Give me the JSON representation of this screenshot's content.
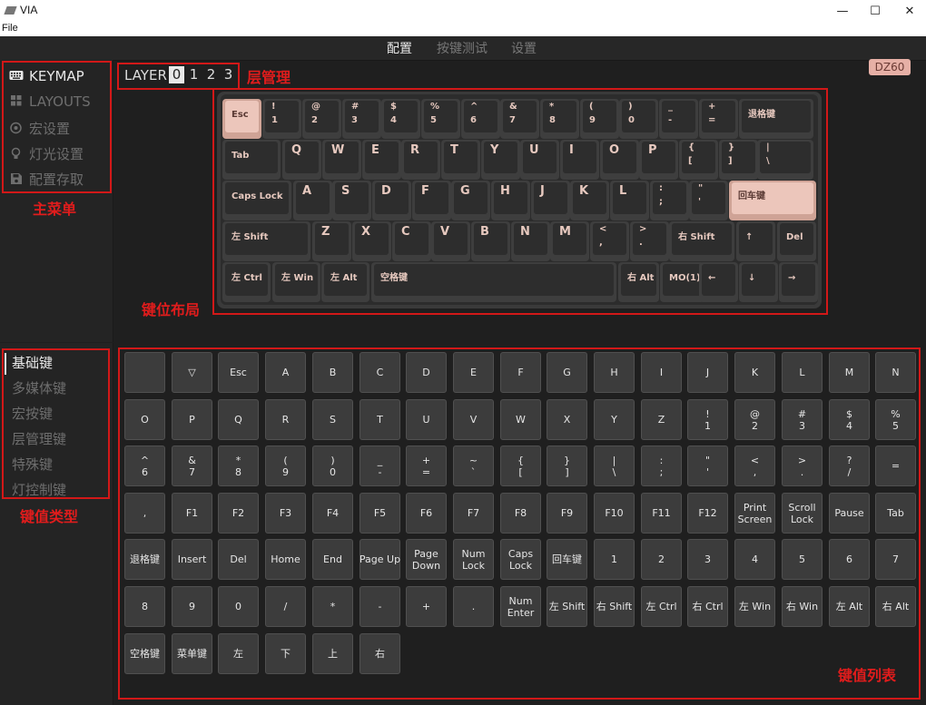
{
  "window": {
    "title": "VIA",
    "menu_file": "File",
    "minimize": "—",
    "maximize": "☐",
    "close": "✕"
  },
  "tabs": [
    "配置",
    "按键测试",
    "设置"
  ],
  "sidebar": {
    "items": [
      {
        "label": "KEYMAP",
        "icon": "keyboard-icon",
        "active": true
      },
      {
        "label": "LAYOUTS",
        "icon": "layouts-icon",
        "active": false
      },
      {
        "label": "宏设置",
        "icon": "macro-icon",
        "active": false
      },
      {
        "label": "灯光设置",
        "icon": "lightbulb-icon",
        "active": false
      },
      {
        "label": "配置存取",
        "icon": "save-icon",
        "active": false
      }
    ]
  },
  "keycode_categories": [
    "基础键",
    "多媒体键",
    "宏按键",
    "层管理键",
    "特殊键",
    "灯控制键"
  ],
  "layer": {
    "label": "LAYER",
    "numbers": [
      "0",
      "1",
      "2",
      "3"
    ],
    "active_index": 0
  },
  "device_badge": "DZ60",
  "annotations": {
    "main_menu": "主菜单",
    "layer_management": "层管理",
    "key_layout": "键位布局",
    "keycode_types": "键值类型",
    "keycode_list": "键值列表"
  },
  "keyboard_rows": [
    [
      "Esc",
      "!|1",
      "@|2",
      "#|3",
      "$|4",
      "%|5",
      "^|6",
      "&|7",
      "*|8",
      "(|9",
      ")|0",
      "_|-",
      "+|=",
      "退格键"
    ],
    [
      "Tab",
      "Q",
      "W",
      "E",
      "R",
      "T",
      "Y",
      "U",
      "I",
      "O",
      "P",
      "{|[",
      "}|]",
      "||\\"
    ],
    [
      "Caps Lock",
      "A",
      "S",
      "D",
      "F",
      "G",
      "H",
      "J",
      "K",
      "L",
      ":|;",
      "\"|'",
      "回车键"
    ],
    [
      "左 Shift",
      "Z",
      "X",
      "C",
      "V",
      "B",
      "N",
      "M",
      "<|,",
      ">|.",
      "右 Shift",
      "↑",
      "Del"
    ],
    [
      "左 Ctrl",
      "左 Win",
      "左 Alt",
      "空格键",
      "右 Alt",
      "MO(1)",
      "←",
      "↓",
      "→"
    ]
  ],
  "keycodes": [
    "",
    "▽",
    "Esc",
    "A",
    "B",
    "C",
    "D",
    "E",
    "F",
    "G",
    "H",
    "I",
    "J",
    "K",
    "L",
    "M",
    "N",
    "O",
    "P",
    "Q",
    "R",
    "S",
    "T",
    "U",
    "V",
    "W",
    "X",
    "Y",
    "Z",
    "!\n1",
    "@\n2",
    "#\n3",
    "$\n4",
    "%\n5",
    "^\n6",
    "&\n7",
    "*\n8",
    "(\n9",
    ")\n0",
    "_\n-",
    "+\n=",
    "~\n`",
    "{\n[",
    "}\n]",
    "|\n\\",
    ":\n;",
    "\"\n'",
    "<\n,",
    ">\n.",
    "?\n/",
    "=",
    ",",
    "F1",
    "F2",
    "F3",
    "F4",
    "F5",
    "F6",
    "F7",
    "F8",
    "F9",
    "F10",
    "F11",
    "F12",
    "Print\nScreen",
    "Scroll\nLock",
    "Pause",
    "Tab",
    "退格键",
    "Insert",
    "Del",
    "Home",
    "End",
    "Page Up",
    "Page\nDown",
    "Num\nLock",
    "Caps\nLock",
    "回车键",
    "1",
    "2",
    "3",
    "4",
    "5",
    "6",
    "7",
    "8",
    "9",
    "0",
    "/",
    "*",
    "-",
    "+",
    ".",
    "Num\nEnter",
    "左 Shift",
    "右 Shift",
    "左 Ctrl",
    "右 Ctrl",
    "左 Win",
    "右 Win",
    "左 Alt",
    "右 Alt",
    "空格键",
    "菜单键",
    "左",
    "下",
    "上",
    "右"
  ],
  "colors": {
    "accent_key": "#ecc6bb",
    "key_legend": "#e7c9bf",
    "annotation_red": "#d21818",
    "badge": "#e6b0a6"
  }
}
